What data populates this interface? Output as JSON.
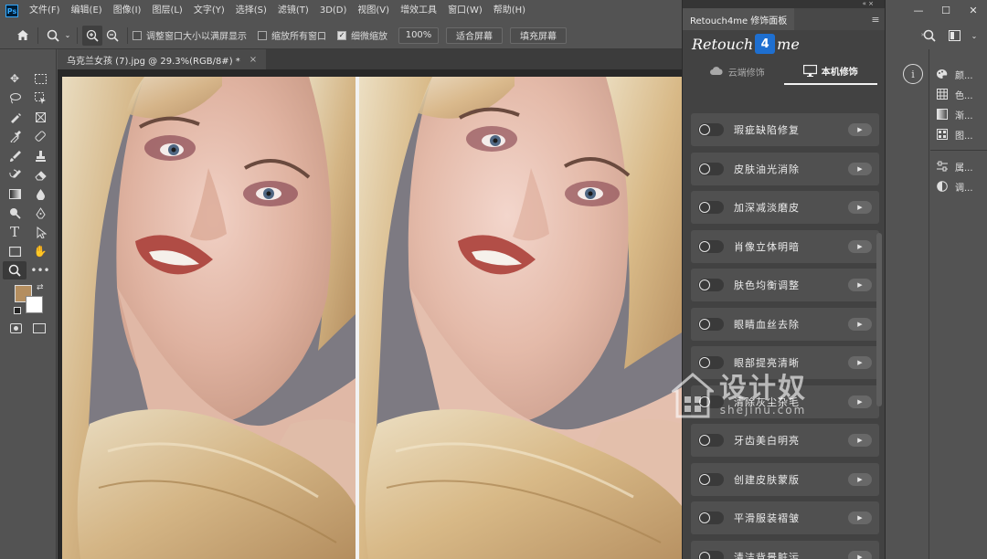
{
  "app": {
    "logo": "Ps"
  },
  "menu": [
    "文件(F)",
    "编辑(E)",
    "图像(I)",
    "图层(L)",
    "文字(Y)",
    "选择(S)",
    "滤镜(T)",
    "3D(D)",
    "视图(V)",
    "增效工具",
    "窗口(W)",
    "帮助(H)"
  ],
  "options_bar": {
    "resize_windows_label": "调整窗口大小以满屏显示",
    "zoom_all_windows_label": "缩放所有窗口",
    "scrubby_zoom_label": "细微缩放",
    "zoom_value": "100%",
    "fit_screen_label": "适合屏幕",
    "fill_screen_label": "填充屏幕"
  },
  "document": {
    "tab_title": "乌克兰女孩 (7).jpg @ 29.3%(RGB/8#) *",
    "close": "×"
  },
  "colors": {
    "foreground": "#b48e5f",
    "background": "#ffffff",
    "accent": "#1e6fd0"
  },
  "retouch_panel": {
    "topstrip": "« ×",
    "title": "Retouch4me 修饰面板",
    "logo_left": "Retouch",
    "logo_mark": "4",
    "logo_right": "me",
    "tabs": [
      {
        "label": "云端修饰",
        "icon": "cloud-icon",
        "active": false
      },
      {
        "label": "本机修饰",
        "icon": "monitor-icon",
        "active": true
      }
    ],
    "features": [
      "瑕疵缺陷修复",
      "皮肤油光消除",
      "加深减淡磨皮",
      "肖像立体明暗",
      "肤色均衡调整",
      "眼睛血丝去除",
      "眼部提亮清晰",
      "清除灰尘杂毛",
      "牙齿美白明亮",
      "创建皮肤蒙版",
      "平滑服装褶皱",
      "清洁背景脏污"
    ]
  },
  "right_dock": {
    "items": [
      {
        "label": "颜...",
        "icon": "palette-icon"
      },
      {
        "label": "色...",
        "icon": "swatches-icon"
      },
      {
        "label": "渐...",
        "icon": "gradient-icon"
      },
      {
        "label": "图...",
        "icon": "patterns-icon"
      },
      {
        "label": "属...",
        "icon": "properties-icon"
      },
      {
        "label": "调...",
        "icon": "adjustments-icon"
      }
    ]
  },
  "watermark": {
    "main": "设计奴",
    "sub": "shejinu.com"
  }
}
